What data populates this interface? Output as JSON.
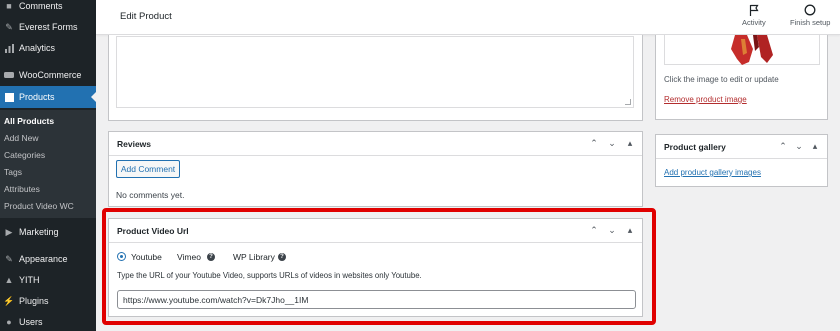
{
  "sidebar": {
    "items": [
      {
        "label": "Comments",
        "icon": "comment-icon"
      },
      {
        "label": "Everest Forms",
        "icon": "forms-icon"
      },
      {
        "label": "Analytics",
        "icon": "analytics-icon"
      },
      {
        "label": "WooCommerce",
        "icon": "woocommerce-icon"
      },
      {
        "label": "Products",
        "icon": "products-icon"
      },
      {
        "label": "Marketing",
        "icon": "marketing-icon"
      },
      {
        "label": "Appearance",
        "icon": "appearance-icon"
      },
      {
        "label": "YITH",
        "icon": "yith-icon"
      },
      {
        "label": "Plugins",
        "icon": "plugins-icon"
      },
      {
        "label": "Users",
        "icon": "users-icon"
      }
    ],
    "submenu": [
      "All Products",
      "Add New",
      "Categories",
      "Tags",
      "Attributes",
      "Product Video WC"
    ]
  },
  "topbar": {
    "title": "Edit Product",
    "activity_label": "Activity",
    "finish_setup_label": "Finish setup"
  },
  "reviews": {
    "title": "Reviews",
    "add_comment_label": "Add Comment",
    "empty_text": "No comments yet."
  },
  "video": {
    "title": "Product Video Url",
    "options": [
      "Youtube",
      "Vimeo",
      "WP Library"
    ],
    "selected": "Youtube",
    "help_text": "Type the URL of your Youtube Video, supports URLs of videos in websites only Youtube.",
    "url_value": "https://www.youtube.com/watch?v=Dk7Jho__1IM"
  },
  "product_image": {
    "hint": "Click the image to edit or update",
    "remove_label": "Remove product image"
  },
  "gallery": {
    "title": "Product gallery",
    "add_label": "Add product gallery images"
  },
  "colors": {
    "sidebar_bg": "#1d2327",
    "accent": "#2271b1",
    "highlight_frame": "#e00000",
    "danger_link": "#b32d2e"
  }
}
